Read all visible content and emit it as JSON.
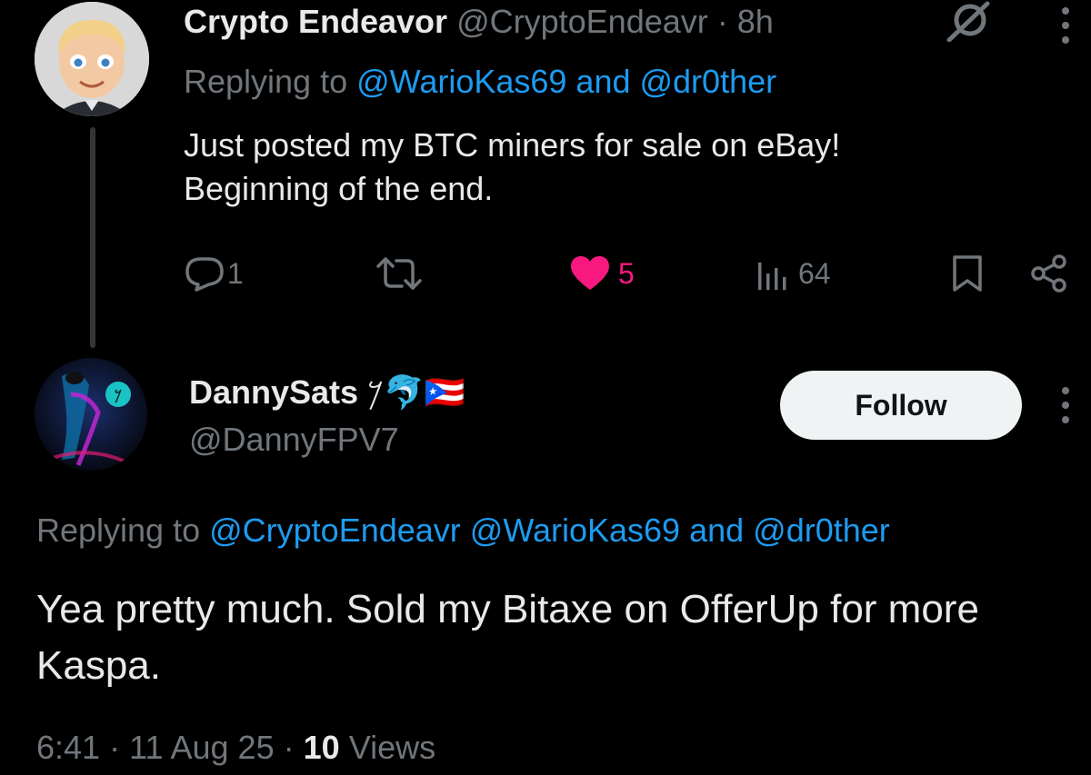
{
  "tweet1": {
    "author_name": "Crypto Endeavor",
    "author_handle": "@CryptoEndeavr",
    "separator": "·",
    "time": "8h",
    "reply_prefix": "Replying to",
    "reply_to": "@WarioKas69 and @dr0ther",
    "text": "Just posted my BTC miners for sale on eBay!\nBeginning of the end.",
    "replies": "1",
    "likes": "5",
    "views": "64",
    "liked": true
  },
  "tweet2": {
    "author_name": "DannySats",
    "name_emojis": "𐤊🐬🇵🇷",
    "author_handle": "@DannyFPV7",
    "follow_label": "Follow",
    "reply_prefix": "Replying to",
    "reply_to": "@CryptoEndeavr @WarioKas69 and @dr0ther",
    "text": "Yea pretty much. Sold my Bitaxe on OfferUp for more Kaspa.",
    "time": "6:41",
    "sep1": "·",
    "date": "11 Aug 25",
    "sep2": "·",
    "views_count": "10",
    "views_label": "Views"
  },
  "icons": {
    "reply": "reply-icon",
    "retweet": "retweet-icon",
    "like": "heart-icon",
    "views": "views-chart-icon",
    "bookmark": "bookmark-icon",
    "share": "share-icon",
    "more": "more-vertical-icon",
    "grok": "grok-icon"
  },
  "colors": {
    "background": "#000000",
    "text": "#e7e9ea",
    "muted": "#71767b",
    "link": "#1d9bf0",
    "like": "#f91880",
    "follow_button": "#eff3f4"
  }
}
